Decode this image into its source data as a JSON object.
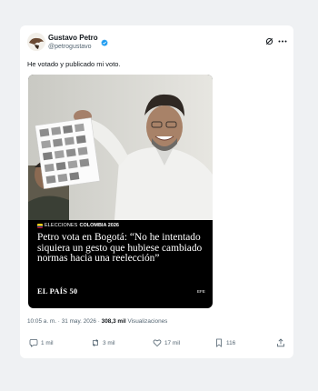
{
  "author": {
    "name": "Gustavo Petro",
    "handle": "@petrogustavo",
    "verified": true,
    "verified_color": "#1d9bf0"
  },
  "tweet": {
    "text": "He votado y publicado mi voto."
  },
  "media": {
    "section_prefix": "ELECCIONES",
    "section_bold": "COLOMBIA 2026",
    "headline": "Petro vota en Bogotá: “No he intentado siquiera un gesto que hubiese cambiado normas hacia una reelección”",
    "brand": "EL PAÍS",
    "brand_badge": "50",
    "credit": "EFE"
  },
  "meta": {
    "time": "10:05 a. m.",
    "separator": "·",
    "date": "31 may. 2026",
    "views_count": "308,3 mil",
    "views_label": "Visualizaciones"
  },
  "actions": {
    "replies": "1 mil",
    "reposts": "3 mil",
    "likes": "17 mil",
    "bookmarks": "116"
  },
  "icons": [
    "grok-icon",
    "more-icon",
    "reply-icon",
    "repost-icon",
    "like-icon",
    "bookmark-icon",
    "share-icon",
    "verified-badge-icon"
  ],
  "colors": {
    "text_primary": "#0f1419",
    "text_secondary": "#536471",
    "background": "#eff1f3"
  }
}
